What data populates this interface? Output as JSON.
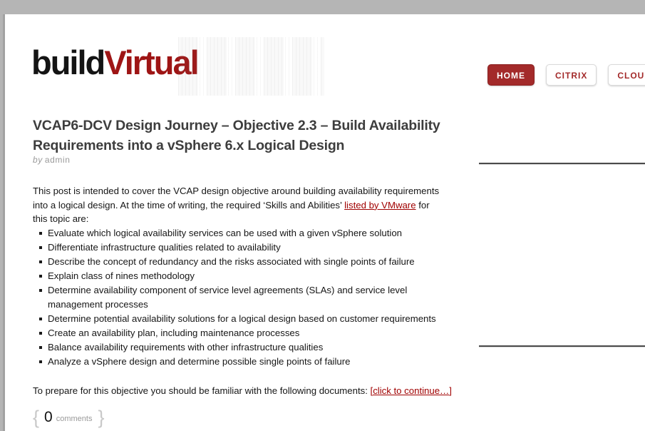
{
  "site": {
    "logo_black": "build",
    "logo_red": "Virtual"
  },
  "nav": {
    "items": [
      {
        "label": "HOME",
        "active": true
      },
      {
        "label": "CITRIX",
        "active": false
      },
      {
        "label": "CLOUD",
        "active": false
      },
      {
        "label": "",
        "active": false
      }
    ]
  },
  "post": {
    "title": "VCAP6-DCV Design Journey – Objective 2.3 – Build Availability Requirements into a vSphere 6.x Logical Design",
    "byline_prefix": "by",
    "author": "admin",
    "intro_before_link": "This post is intended to cover the VCAP design objective around building availability requirements into a logical design. At the time of writing, the required ‘Skills and Abilities’ ",
    "intro_link": "listed by VMware",
    "intro_after_link": " for this topic are:",
    "skills": [
      "Evaluate which logical availability services can be used with a given vSphere solution",
      "Differentiate infrastructure qualities related to availability",
      "Describe the concept of redundancy and the risks associated with single points of failure",
      "Explain class of nines methodology",
      "Determine availability component of service level agreements (SLAs) and service level management processes",
      "Determine potential availability solutions for a logical design based on customer requirements",
      "Create an availability plan, including maintenance processes",
      "Balance availability requirements with other infrastructure qualities",
      "Analyze a vSphere design and determine possible single points of failure"
    ],
    "outro_before_link": "To prepare for this objective you should be familiar with the following documents: ",
    "outro_link": "[click to continue…]",
    "comments": {
      "open_brace": "{",
      "count": "0",
      "label": "comments",
      "close_brace": "}"
    }
  },
  "colors": {
    "accent_red": "#a32a2a",
    "link_red": "#a00000",
    "logo_red": "#9e1515",
    "body_background": "#b5b5b5"
  }
}
